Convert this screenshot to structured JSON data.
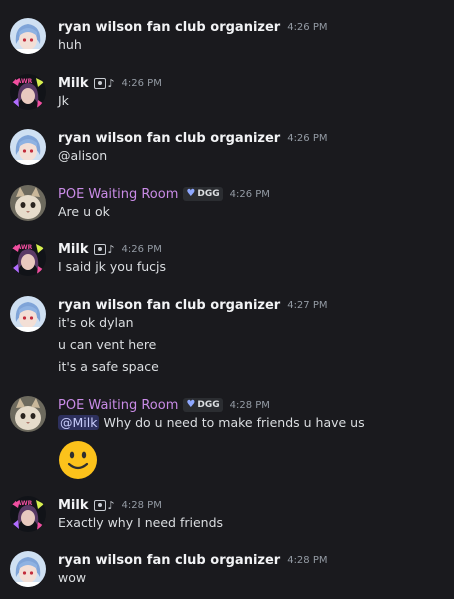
{
  "messages": [
    {
      "author": "ryan wilson fan club organizer",
      "time": "4:26 PM",
      "lines": [
        "huh"
      ]
    },
    {
      "author": "Milk",
      "time": "4:26 PM",
      "lines": [
        "Jk"
      ]
    },
    {
      "author": "ryan wilson fan club organizer",
      "time": "4:26 PM",
      "lines": [
        "@alison"
      ]
    },
    {
      "author": "POE Waiting Room",
      "tag": "DGG",
      "time": "4:26 PM",
      "lines": [
        "Are u ok"
      ]
    },
    {
      "author": "Milk",
      "time": "4:26 PM",
      "lines": [
        "I said jk you fucjs"
      ]
    },
    {
      "author": "ryan wilson fan club organizer",
      "time": "4:27 PM",
      "lines": [
        "it's ok dylan",
        "u can vent here",
        "it's a safe space"
      ]
    },
    {
      "author": "POE Waiting Room",
      "tag": "DGG",
      "time": "4:28 PM",
      "mention": "@Milk",
      "lines": [
        "Why do u need to make friends u have us"
      ],
      "emoji": "slightly-smiling-face"
    },
    {
      "author": "Milk",
      "time": "4:28 PM",
      "lines": [
        "Exactly why I need friends"
      ]
    },
    {
      "author": "ryan wilson fan club organizer",
      "time": "4:28 PM",
      "lines": [
        "wow"
      ]
    }
  ],
  "colors": {
    "background": "#1a1a1e",
    "username_default": "#f2f3f5",
    "username_poe": "#c98be6",
    "timestamp": "#949ba4",
    "mention_bg": "#5865f24d",
    "tag_heart": "#8ea8ff"
  }
}
